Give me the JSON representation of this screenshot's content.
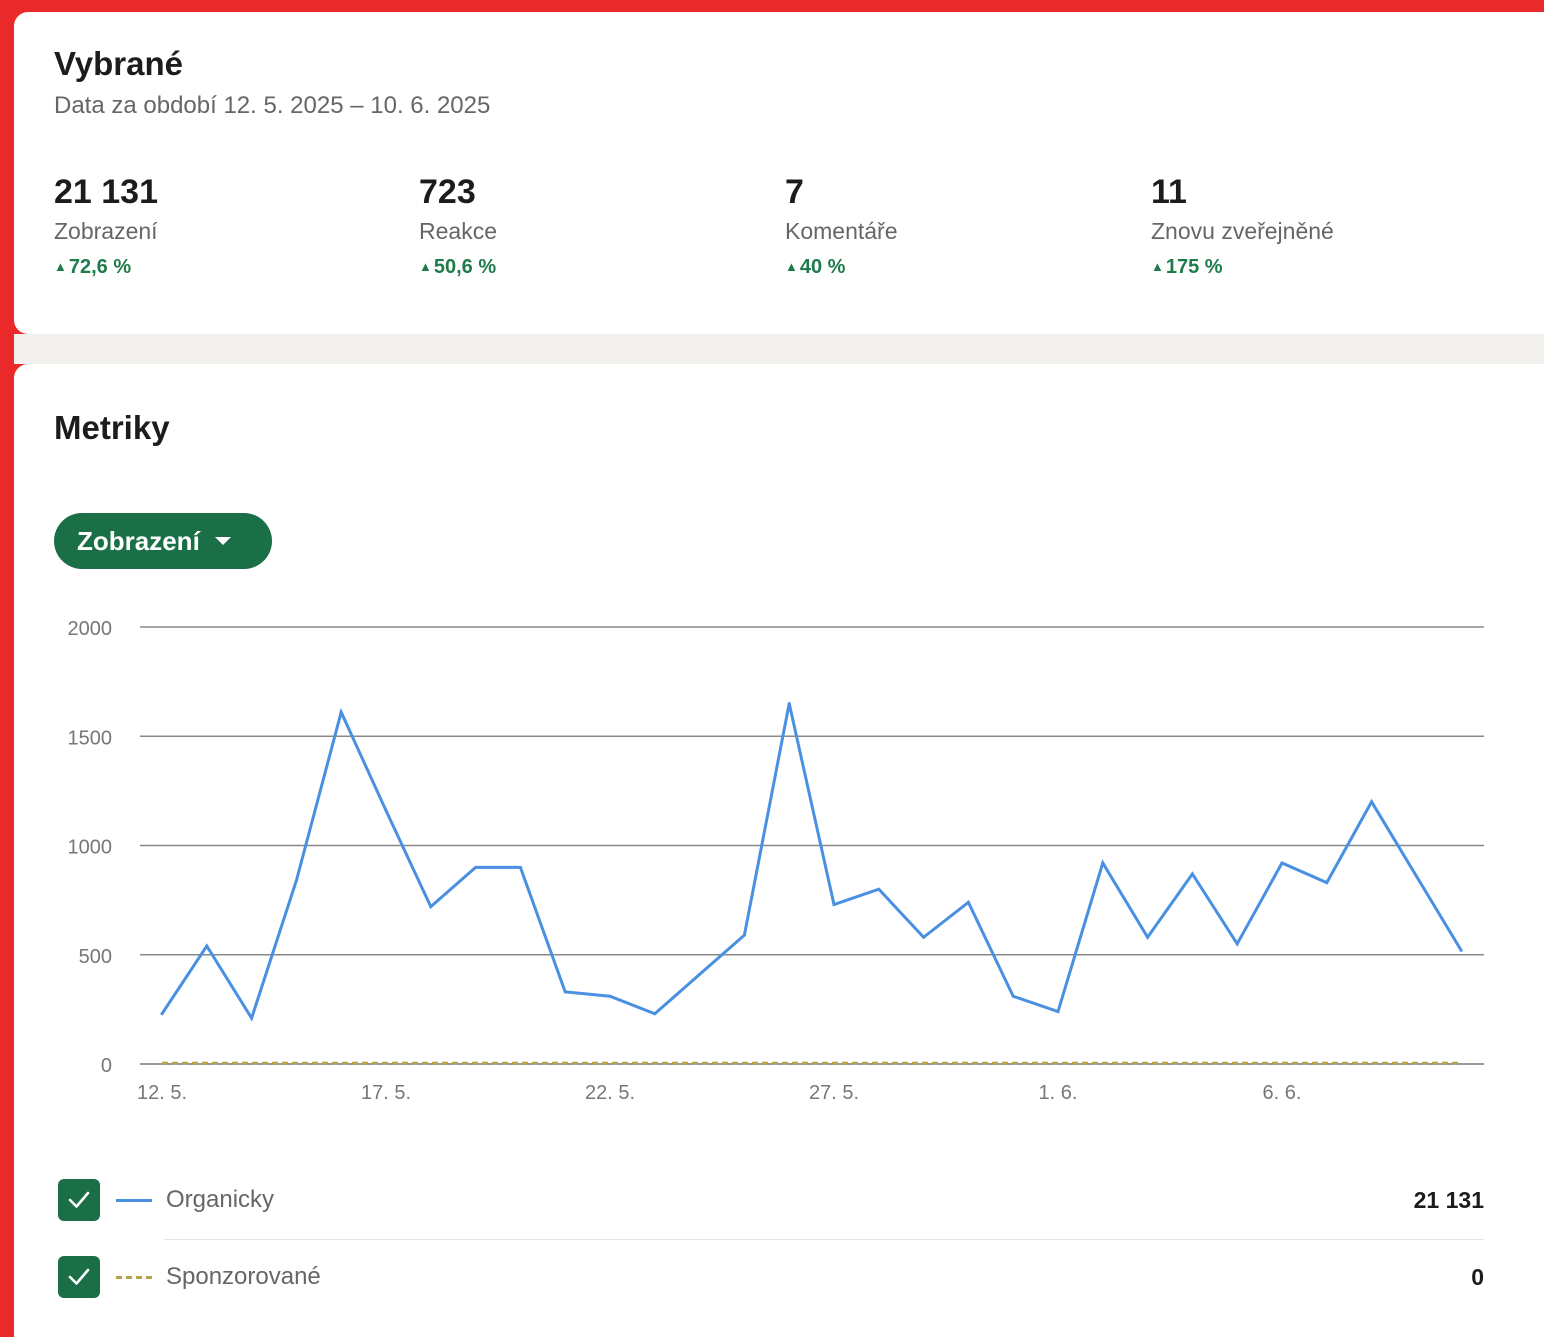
{
  "summary": {
    "title": "Vybrané",
    "subtitle": "Data za období 12. 5. 2025 – 10. 6. 2025",
    "stats": [
      {
        "value": "21 131",
        "label": "Zobrazení",
        "change": "72,6 %"
      },
      {
        "value": "723",
        "label": "Reakce",
        "change": "50,6 %"
      },
      {
        "value": "7",
        "label": "Komentáře",
        "change": "40 %"
      },
      {
        "value": "11",
        "label": "Znovu zveřejněné",
        "change": "175 %"
      }
    ],
    "change_arrow": "▲"
  },
  "metrics": {
    "title": "Metriky",
    "dropdown_label": "Zobrazení"
  },
  "colors": {
    "accent_green": "#1b6f47",
    "organic_line": "#4a90e2",
    "sponsored_line": "#b7a44a",
    "frame": "#ea2a2a"
  },
  "chart_data": {
    "type": "line",
    "x": [
      "12. 5.",
      "13. 5.",
      "14. 5.",
      "15. 5.",
      "16. 5.",
      "17. 5.",
      "18. 5.",
      "19. 5.",
      "20. 5.",
      "21. 5.",
      "22. 5.",
      "23. 5.",
      "24. 5.",
      "25. 5.",
      "26. 5.",
      "27. 5.",
      "28. 5.",
      "29. 5.",
      "30. 5.",
      "31. 5.",
      "1. 6.",
      "2. 6.",
      "3. 6.",
      "4. 6.",
      "5. 6.",
      "6. 6.",
      "7. 6.",
      "8. 6.",
      "9. 6.",
      "10. 6."
    ],
    "tick_labels": [
      "12. 5.",
      "17. 5.",
      "22. 5.",
      "27. 5.",
      "1. 6.",
      "6. 6."
    ],
    "ylim": [
      0,
      2000
    ],
    "yticks": [
      0,
      500,
      1000,
      1500,
      2000
    ],
    "grid": true,
    "series": [
      {
        "name": "Organicky",
        "total": "21 131",
        "style": "solid",
        "values": [
          230,
          540,
          210,
          840,
          1610,
          1160,
          720,
          900,
          900,
          330,
          310,
          230,
          410,
          590,
          1650,
          730,
          800,
          580,
          740,
          310,
          240,
          920,
          580,
          870,
          550,
          920,
          830,
          1200,
          860,
          520
        ]
      },
      {
        "name": "Sponzorované",
        "total": "0",
        "style": "dashed",
        "values": [
          0,
          0,
          0,
          0,
          0,
          0,
          0,
          0,
          0,
          0,
          0,
          0,
          0,
          0,
          0,
          0,
          0,
          0,
          0,
          0,
          0,
          0,
          0,
          0,
          0,
          0,
          0,
          0,
          0,
          0
        ]
      }
    ]
  }
}
